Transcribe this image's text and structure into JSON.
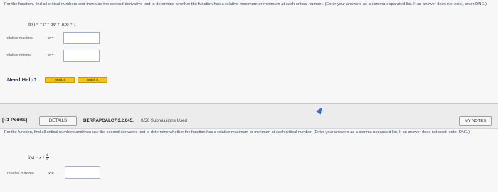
{
  "q1": {
    "prompt": "For the function, find all critical numbers and then use the second-derivative test to determine whether the function has a relative maximum or minimum at each critical number. (Enter your answers as a comma-separated list. If an answer does not exist, enter DNE.)",
    "function": "f(x) = −x⁴ − 8x³ + 10x² + 1",
    "rows": [
      {
        "label": "relative maxima",
        "eq": "x =",
        "value": ""
      },
      {
        "label": "relative minima",
        "eq": "x =",
        "value": ""
      }
    ],
    "help": {
      "label": "Need Help?",
      "read": "Read It",
      "watch": "Watch It"
    }
  },
  "q2": {
    "points": "[-/1 Points]",
    "details": "DETAILS",
    "course": "BERRAPCALC7 3.2.045.",
    "submissions": "0/50 Submissions Used",
    "my_notes": "MY NOTES",
    "prompt": "For the function, find all critical numbers and then use the second-derivative test to determine whether the function has a relative maximum or minimum at each critical number. (Enter your answers as a comma-separated list. If an answer does not exist, enter DNE.)",
    "function_left": "f(x) = x +",
    "frac_num": "4",
    "frac_den": "x",
    "rows": [
      {
        "label": "relative maxima",
        "eq": "x =",
        "value": ""
      }
    ]
  },
  "colors": {
    "accent": "#f3c21a",
    "link": "#3a4a6b",
    "cursor": "#2f6fd6"
  }
}
